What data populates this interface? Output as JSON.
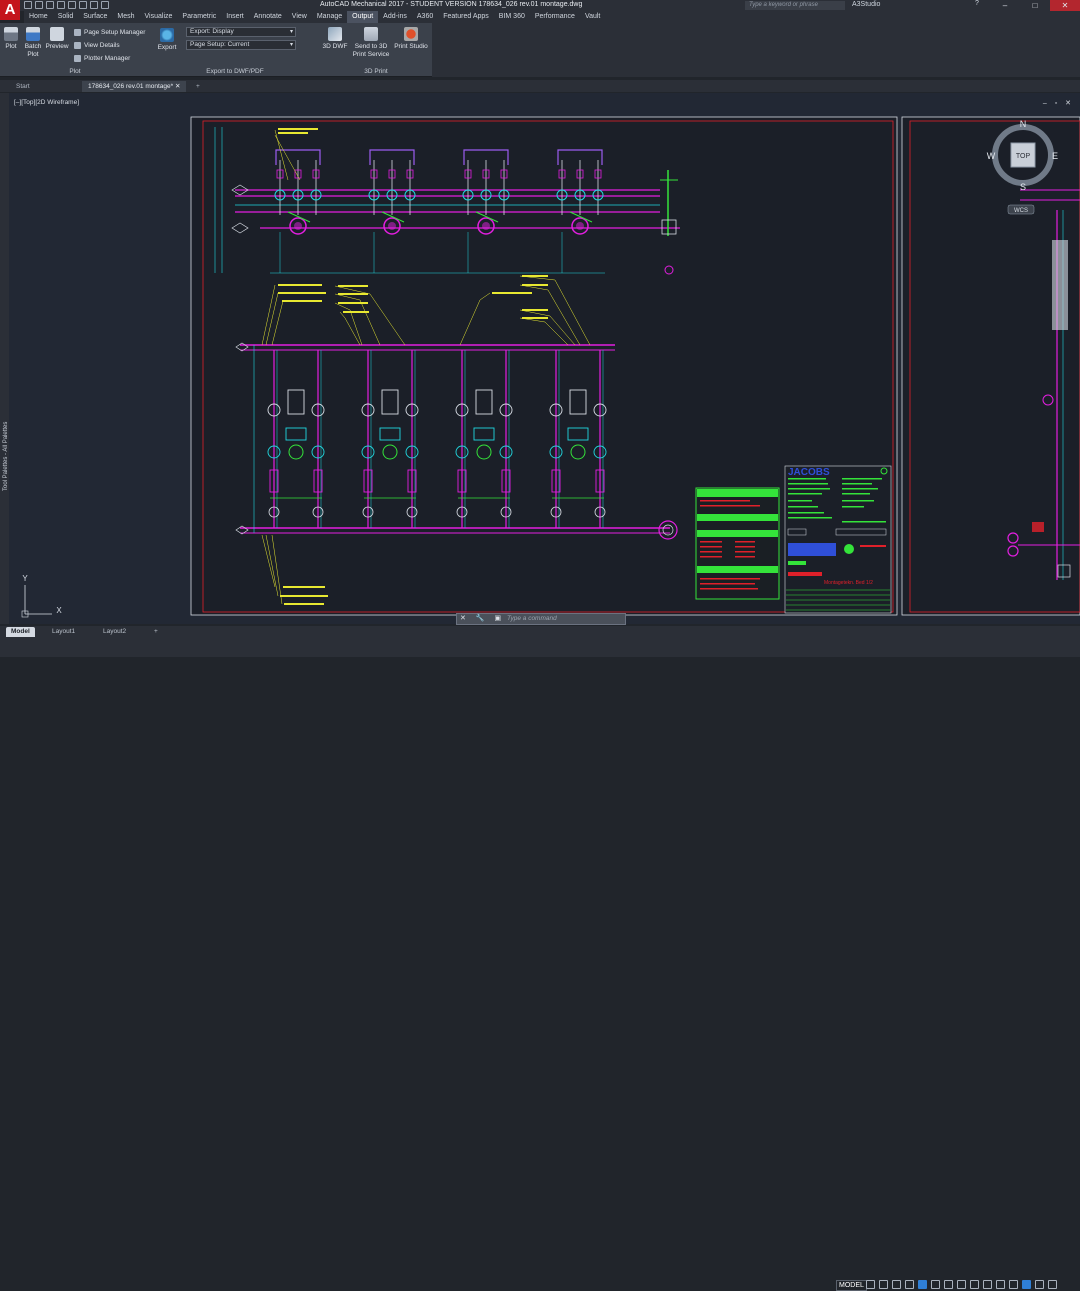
{
  "app": {
    "logo": "A",
    "title": "AutoCAD Mechanical 2017 - STUDENT VERSION    178634_026 rev.01 montage.dwg",
    "search_placeholder": "Type a keyword or phrase",
    "user": "A3Studio",
    "help": "?"
  },
  "window_controls": {
    "minimize": "–",
    "maximize": "□",
    "close": "✕"
  },
  "ribbon_tabs": [
    "Home",
    "Solid",
    "Surface",
    "Mesh",
    "Visualize",
    "Parametric",
    "Insert",
    "Annotate",
    "View",
    "Manage",
    "Output",
    "Add-ins",
    "A360",
    "Featured Apps",
    "BIM 360",
    "Performance",
    "Vault"
  ],
  "active_tab": "Output",
  "ribbon": {
    "plot": {
      "label": "Plot"
    },
    "batch_plot": {
      "label": "Batch\nPlot"
    },
    "preview": {
      "label": "Preview"
    },
    "page_setup_manager": {
      "label": "Page Setup Manager"
    },
    "view_details": {
      "label": "View Details"
    },
    "plotter_manager": {
      "label": "Plotter Manager"
    },
    "export": {
      "label": "Export"
    },
    "export_dropdown": {
      "value": "Export: Display"
    },
    "page_setup_dropdown": {
      "value": "Page Setup: Current"
    },
    "dwf_3d": {
      "label": "3D DWF"
    },
    "send_to_3d": {
      "label": "Send to 3D\nPrint Service"
    },
    "print_studio": {
      "label": "Print Studio"
    },
    "panels": {
      "plot": "Plot",
      "export": "Export to DWF/PDF",
      "print3d": "3D Print"
    }
  },
  "document_tabs": {
    "start": "Start",
    "active": "178634_026 rev.01 montage*",
    "close": "✕",
    "new": "+"
  },
  "viewport": {
    "label": "[–][Top][2D Wireframe]",
    "controls": "– ▫ ✕",
    "tool_palette": "Tool Palettes - All Palettes"
  },
  "viewcube": {
    "top": "TOP",
    "n": "N",
    "s": "S",
    "e": "E",
    "w": "W",
    "wcs": "WCS"
  },
  "ucs": {
    "x": "X",
    "y": "Y"
  },
  "title_block": {
    "company": "JACOBS",
    "sheet_title": "Montagetekn. Bed 1/2"
  },
  "command_line": {
    "placeholder": "Type a command",
    "icons": "✕ 🔧 ▣"
  },
  "layout_tabs": [
    "Model",
    "Layout1",
    "Layout2"
  ],
  "active_layout": "Model",
  "add_layout": "+",
  "status": {
    "model": "MODEL"
  },
  "colors": {
    "background": "#222834",
    "frame": "#e0202a",
    "pipe_magenta": "#e31fe0",
    "pipe_cyan": "#21d8e0",
    "annotation_yellow": "#e8e831",
    "green": "#34e33a",
    "title_block_blue": "#2f4fd8"
  }
}
